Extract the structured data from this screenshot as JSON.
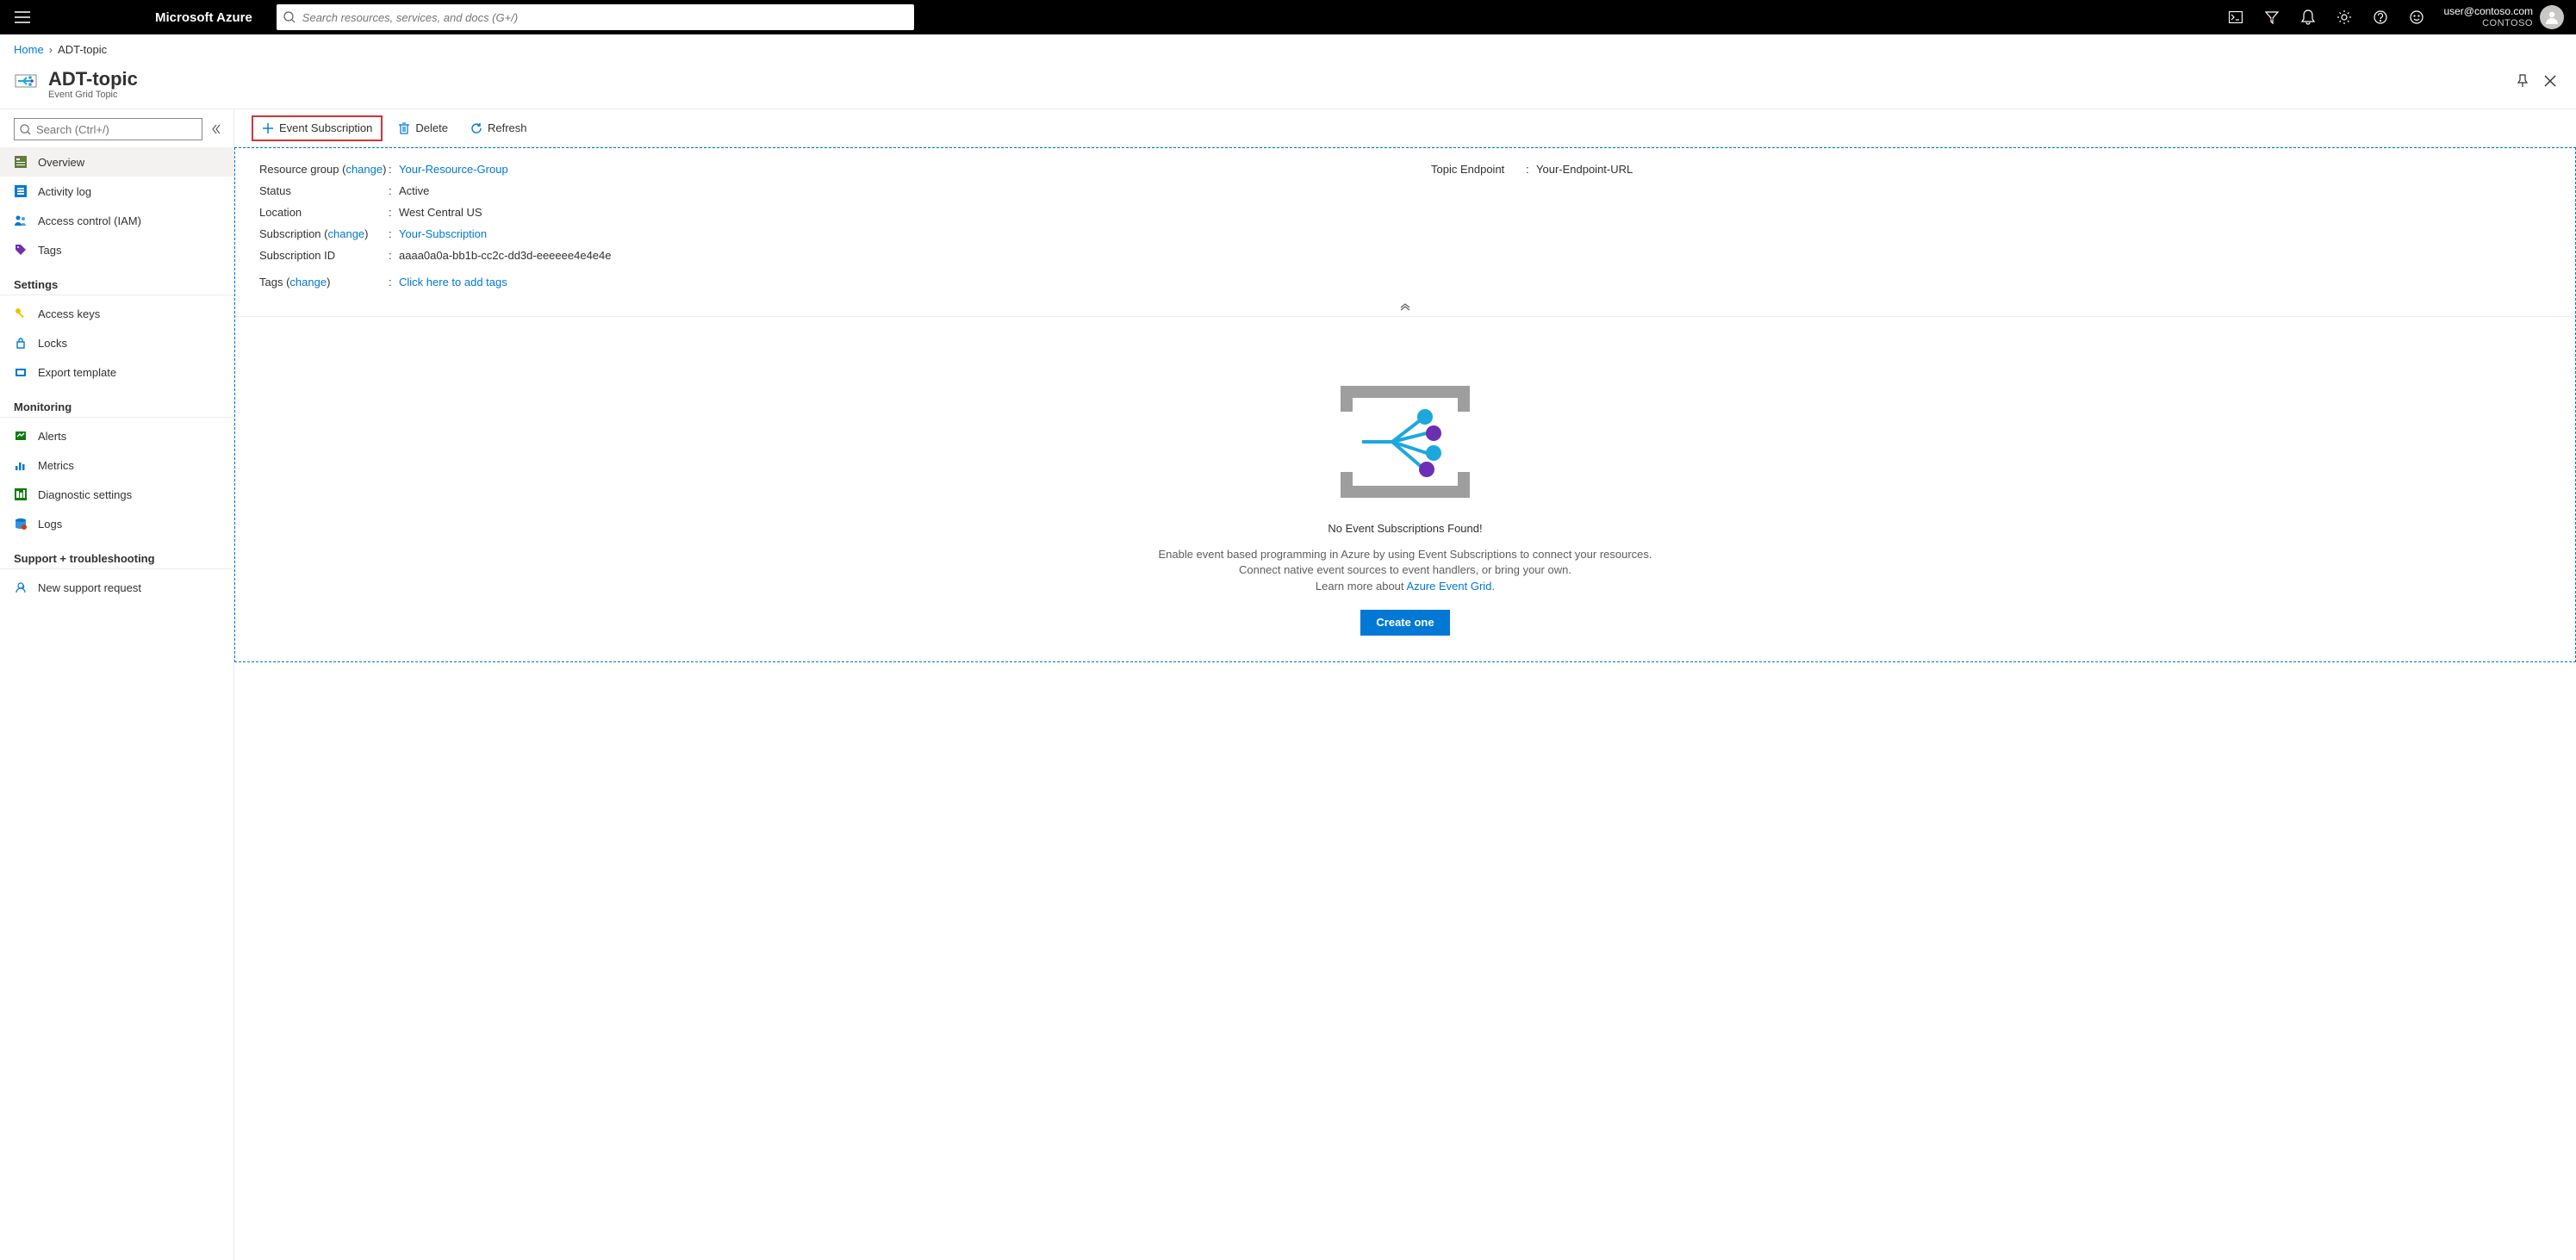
{
  "header": {
    "brand": "Microsoft Azure",
    "search_placeholder": "Search resources, services, and docs (G+/)",
    "user_email": "user@contoso.com",
    "user_dir": "CONTOSO"
  },
  "breadcrumb": {
    "home": "Home",
    "current": "ADT-topic"
  },
  "resource": {
    "name": "ADT-topic",
    "type": "Event Grid Topic"
  },
  "nav": {
    "search_placeholder": "Search (Ctrl+/)",
    "items_top": [
      {
        "label": "Overview",
        "active": true
      },
      {
        "label": "Activity log"
      },
      {
        "label": "Access control (IAM)"
      },
      {
        "label": "Tags"
      }
    ],
    "group_settings": {
      "title": "Settings",
      "items": [
        {
          "label": "Access keys"
        },
        {
          "label": "Locks"
        },
        {
          "label": "Export template"
        }
      ]
    },
    "group_monitoring": {
      "title": "Monitoring",
      "items": [
        {
          "label": "Alerts"
        },
        {
          "label": "Metrics"
        },
        {
          "label": "Diagnostic settings"
        },
        {
          "label": "Logs"
        }
      ]
    },
    "group_support": {
      "title": "Support + troubleshooting",
      "items": [
        {
          "label": "New support request"
        }
      ]
    }
  },
  "toolbar": {
    "event_subscription": "Event Subscription",
    "delete": "Delete",
    "refresh": "Refresh"
  },
  "essentials": {
    "resource_group_label": "Resource group",
    "resource_group_change": "change",
    "resource_group_value": "Your-Resource-Group",
    "status_label": "Status",
    "status_value": "Active",
    "location_label": "Location",
    "location_value": "West Central US",
    "subscription_label": "Subscription",
    "subscription_change": "change",
    "subscription_value": "Your-Subscription",
    "subscription_id_label": "Subscription ID",
    "subscription_id_value": "aaaa0a0a-bb1b-cc2c-dd3d-eeeeee4e4e4e",
    "tags_label": "Tags",
    "tags_change": "change",
    "tags_value": "Click here to add tags",
    "topic_endpoint_label": "Topic Endpoint",
    "topic_endpoint_value": "Your-Endpoint-URL"
  },
  "empty": {
    "title": "No Event Subscriptions Found!",
    "body1": "Enable event based programming in Azure by using Event Subscriptions to connect your resources.",
    "body2": "Connect native event sources to event handlers, or bring your own.",
    "learn_prefix": "Learn more about ",
    "learn_link": "Azure Event Grid",
    "button": "Create one"
  }
}
